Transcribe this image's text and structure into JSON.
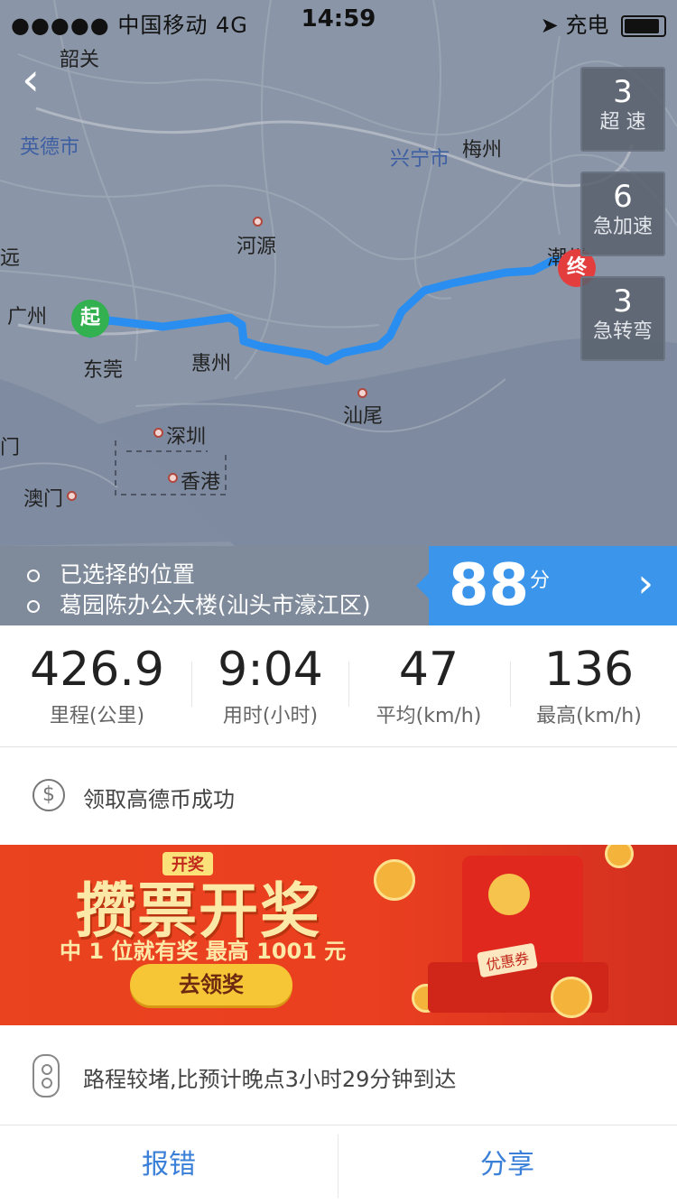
{
  "status_bar": {
    "signal": "●●●●● 中国移动  4G",
    "time": "14:59",
    "battery_label": "充电"
  },
  "map": {
    "back_icon": "chevron-left-icon",
    "cities": {
      "shaoguan": "韶关",
      "yingde": "英德市",
      "xingning": "兴宁市",
      "meizhou": "梅州",
      "heyuan": "河源",
      "guangzhou": "广州",
      "dongguan": "东莞",
      "huizhou": "惠州",
      "shanwei": "汕尾",
      "shenzhen": "深圳",
      "hongkong": "香港",
      "macau": "澳门",
      "chaozhou": "潮州",
      "left_edge_1": "远",
      "left_edge_2": "门"
    },
    "start_pin": "起",
    "end_pin": "终",
    "stats": [
      {
        "count": "3",
        "label": "超 速"
      },
      {
        "count": "6",
        "label": "急加速"
      },
      {
        "count": "3",
        "label": "急转弯"
      }
    ]
  },
  "route": {
    "from": "已选择的位置",
    "to": "葛园陈办公大楼(汕头市濠江区)",
    "score": "88",
    "score_unit": "分"
  },
  "metrics": [
    {
      "value": "426.9",
      "label": "里程(公里)"
    },
    {
      "value": "9:04",
      "label": "用时(小时)"
    },
    {
      "value": "47",
      "label": "平均(km/h)"
    },
    {
      "value": "136",
      "label": "最高(km/h)"
    }
  ],
  "coin_notice": "领取高德币成功",
  "banner": {
    "tag": "开奖",
    "headline": "攒票开奖",
    "subline": "中 1 位就有奖  最高 1001 元",
    "button": "去领奖",
    "coupon": "优惠券"
  },
  "delay_notice": "路程较堵,比预计晚点3小时29分钟到达",
  "actions": {
    "report": "报错",
    "share": "分享"
  },
  "colors": {
    "route_line": "#2a8ef0",
    "score_bg": "#3b95ea",
    "banner_bg": "#e9431f",
    "action_text": "#3a7fd8"
  }
}
